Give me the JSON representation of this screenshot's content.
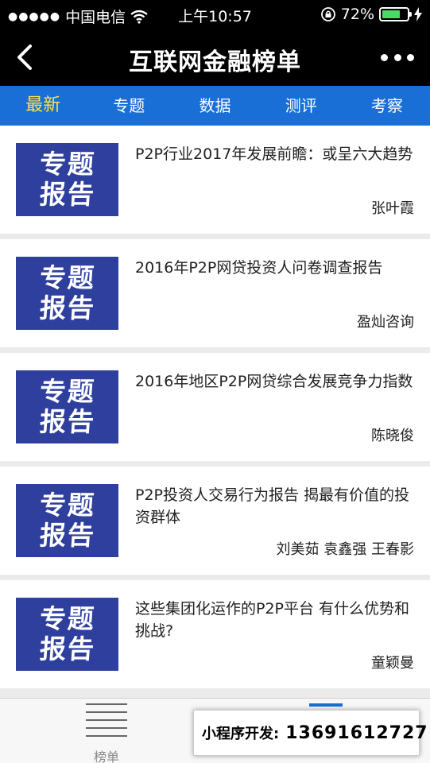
{
  "status_bar": {
    "signal_dots": "●●●●●",
    "carrier": "中国电信",
    "time": "上午10:57",
    "battery_percent": "72%",
    "battery_level": 0.72
  },
  "nav": {
    "title": "互联网金融榜单"
  },
  "tabs": [
    {
      "label": "最新",
      "active": true
    },
    {
      "label": "专题",
      "active": false
    },
    {
      "label": "数据",
      "active": false
    },
    {
      "label": "测评",
      "active": false
    },
    {
      "label": "考察",
      "active": false
    }
  ],
  "thumbnail_text": [
    "专题",
    "报告"
  ],
  "articles": [
    {
      "title": "P2P行业2017年发展前瞻：或呈六大趋势",
      "author": "张叶霞"
    },
    {
      "title": "2016年P2P网贷投资人问卷调查报告",
      "author": "盈灿咨询"
    },
    {
      "title": "2016年地区P2P网贷综合发展竞争力指数",
      "author": "陈晓俊"
    },
    {
      "title": "P2P投资人交易行为报告 揭最有价值的投资群体",
      "author": "刘美茹 袁鑫强 王春影"
    },
    {
      "title": "这些集团化运作的P2P平台 有什么优势和挑战?",
      "author": "童颖曼"
    }
  ],
  "bottom_nav": {
    "left_label": "榜单"
  },
  "promo": {
    "label": "小程序开发:",
    "phone": "13691612727"
  },
  "colors": {
    "tab_bar": "#1a6fd6",
    "active_tab": "#ffe14d",
    "thumbnail": "#2e3f9e",
    "battery": "#4cd964"
  }
}
